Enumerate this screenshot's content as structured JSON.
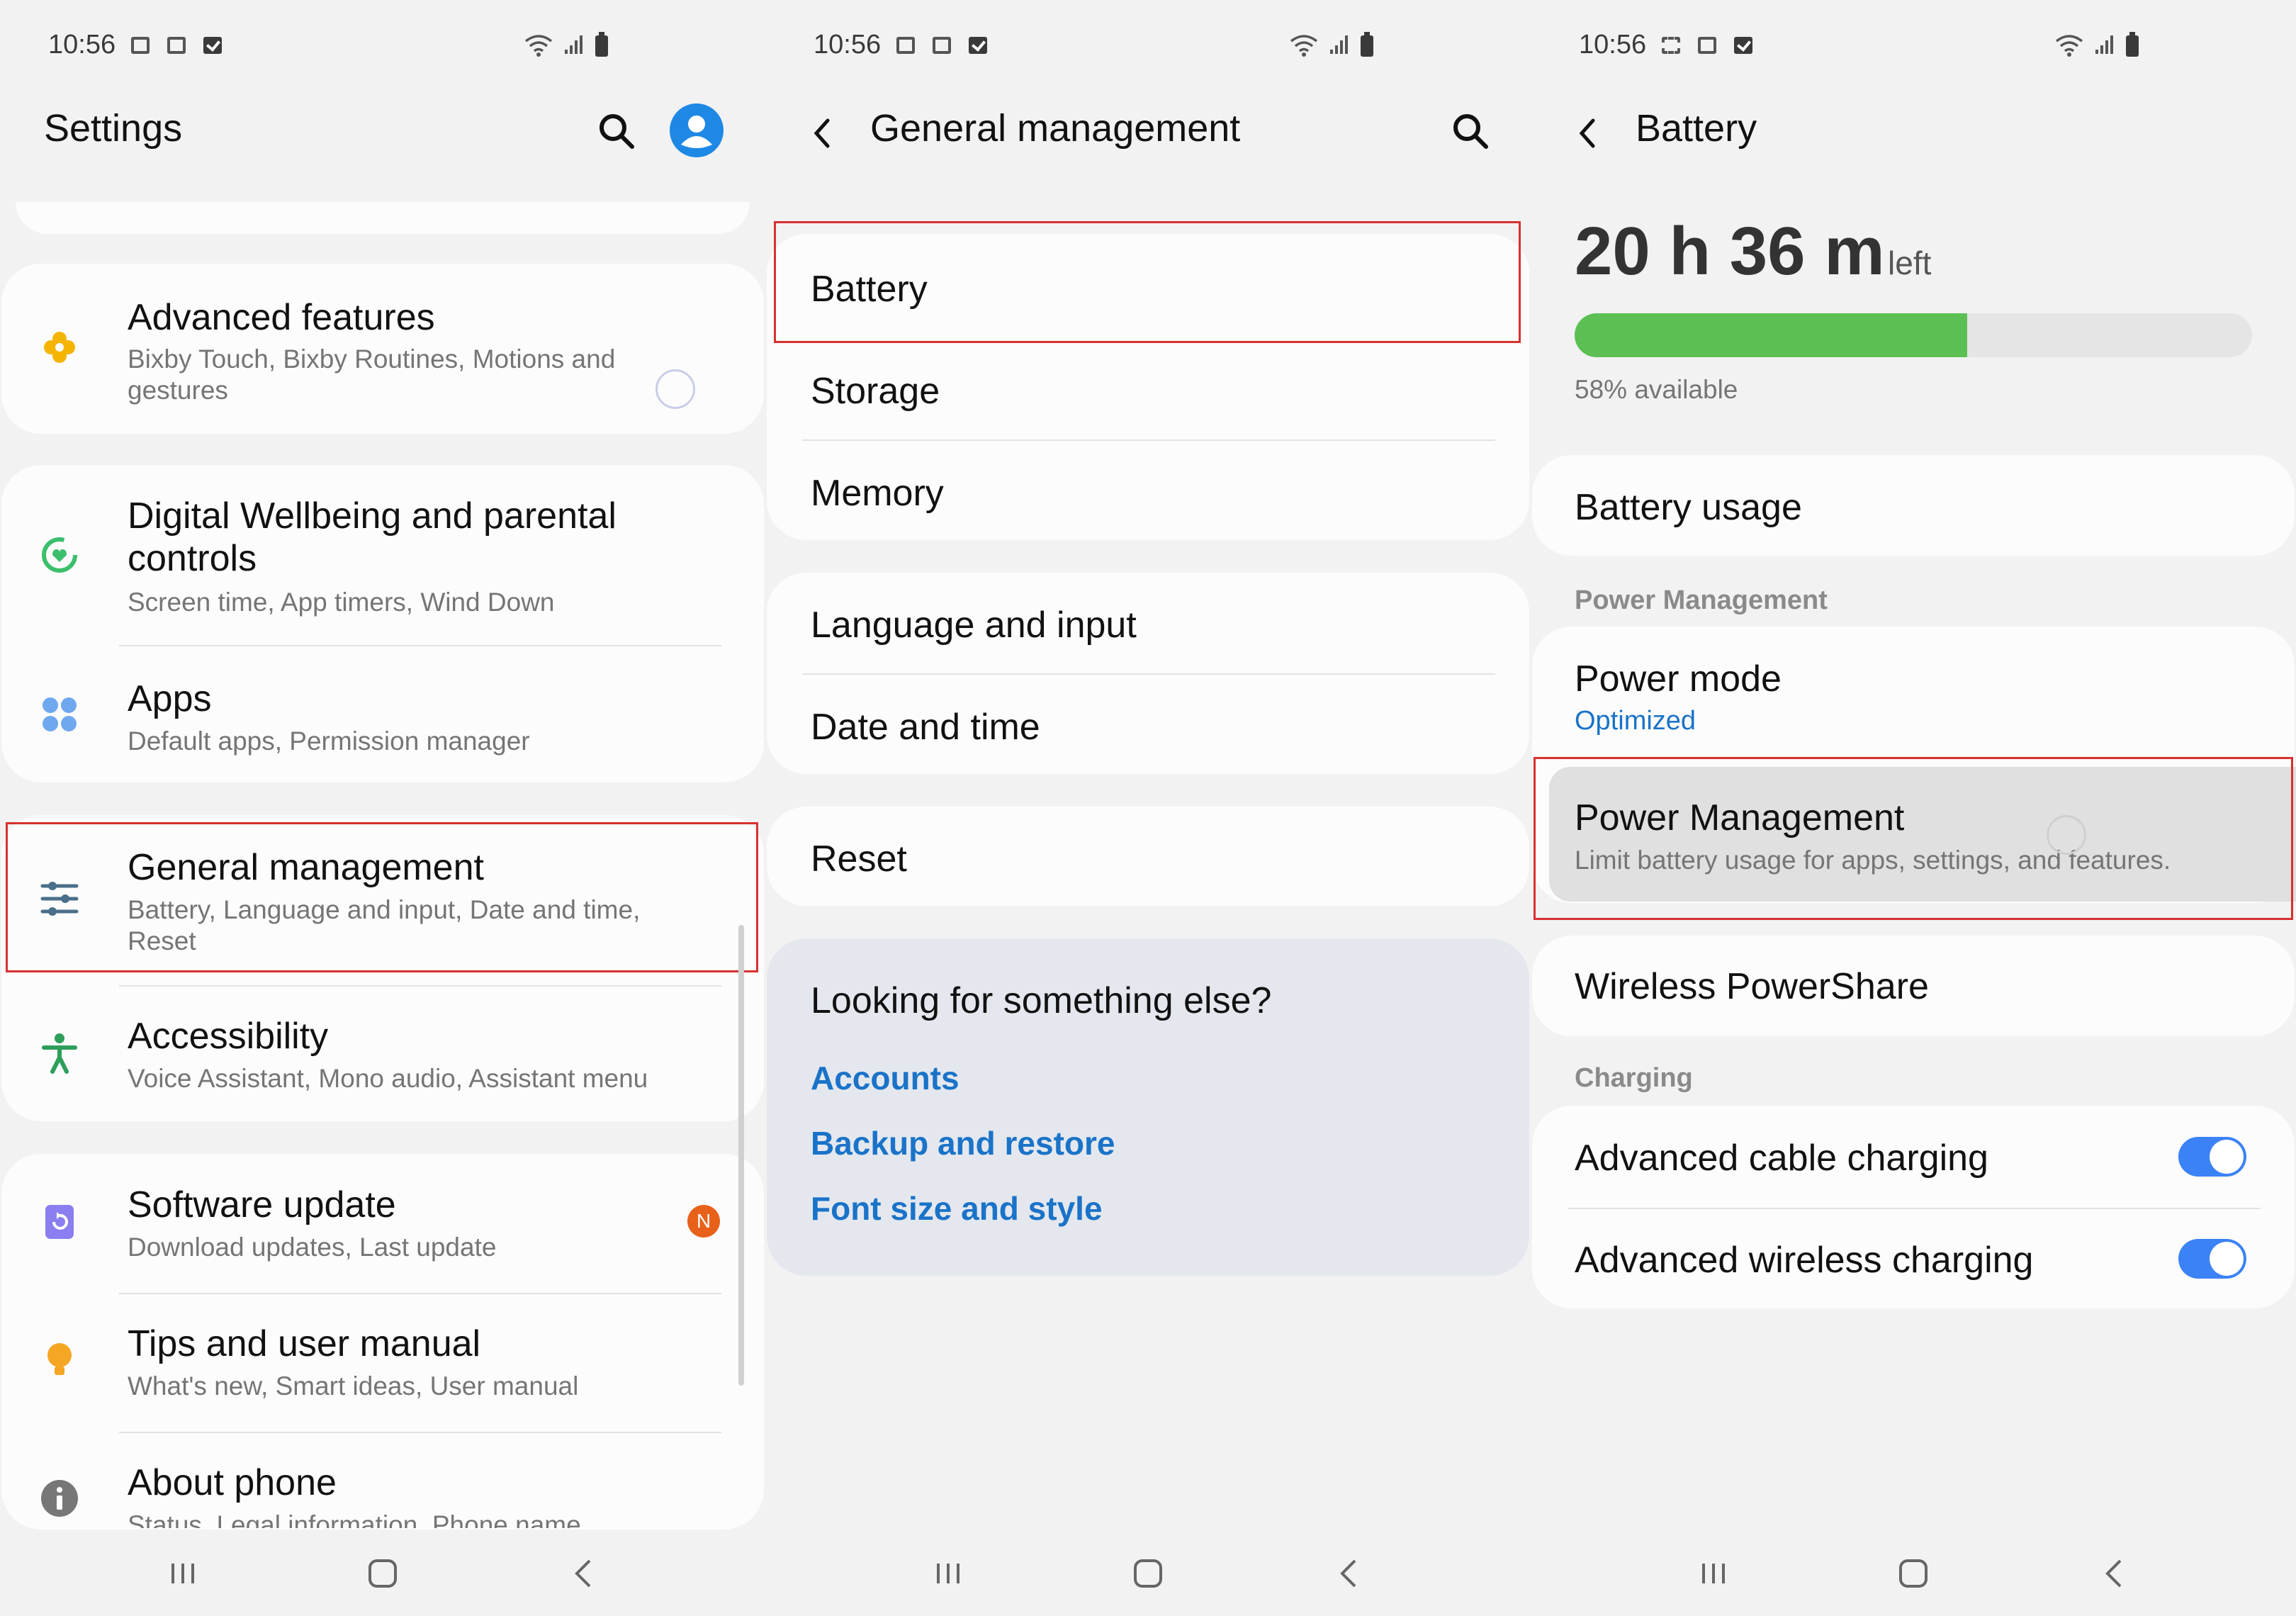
{
  "status_bar": {
    "time": "10:56"
  },
  "panel1": {
    "title": "Settings",
    "rows": [
      {
        "title": "Advanced features",
        "subtitle": "Bixby Touch, Bixby Routines, Motions and gestures"
      },
      {
        "title": "Digital Wellbeing and parental controls",
        "subtitle": "Screen time, App timers, Wind Down"
      },
      {
        "title": "Apps",
        "subtitle": "Default apps, Permission manager"
      },
      {
        "title": "General management",
        "subtitle": "Battery, Language and input, Date and time, Reset"
      },
      {
        "title": "Accessibility",
        "subtitle": "Voice Assistant, Mono audio, Assistant menu"
      },
      {
        "title": "Software update",
        "subtitle": "Download updates, Last update",
        "badge": "N"
      },
      {
        "title": "Tips and user manual",
        "subtitle": "What's new, Smart ideas, User manual"
      },
      {
        "title": "About phone",
        "subtitle": "Status, Legal information, Phone name"
      }
    ]
  },
  "panel2": {
    "title": "General management",
    "items": [
      "Battery",
      "Storage",
      "Memory",
      "Language and input",
      "Date and time",
      "Reset"
    ],
    "suggestions": {
      "heading": "Looking for something else?",
      "links": [
        "Accounts",
        "Backup and restore",
        "Font size and style"
      ]
    }
  },
  "panel3": {
    "title": "Battery",
    "time_left": {
      "hours": "20 h 36 m",
      "suffix": "left"
    },
    "available": "58% available",
    "level_fraction": 0.58,
    "battery_usage": "Battery usage",
    "power_management_label": "Power Management",
    "power_mode": {
      "title": "Power mode",
      "value": "Optimized"
    },
    "power_management": {
      "title": "Power Management",
      "subtitle": "Limit battery usage for apps, settings, and features."
    },
    "wireless_powershare": "Wireless PowerShare",
    "charging_label": "Charging",
    "charging_toggles": [
      {
        "label": "Advanced cable charging",
        "on": true
      },
      {
        "label": "Advanced wireless charging",
        "on": true
      }
    ]
  },
  "colors": {
    "accent": "#1a73c8",
    "highlight": "#d93030",
    "battery": "#5cbf53",
    "toggle": "#3b82f6"
  },
  "icons": [
    "search-icon",
    "avatar-icon",
    "back-icon",
    "recent-apps-icon",
    "home-icon",
    "nav-back-icon"
  ]
}
